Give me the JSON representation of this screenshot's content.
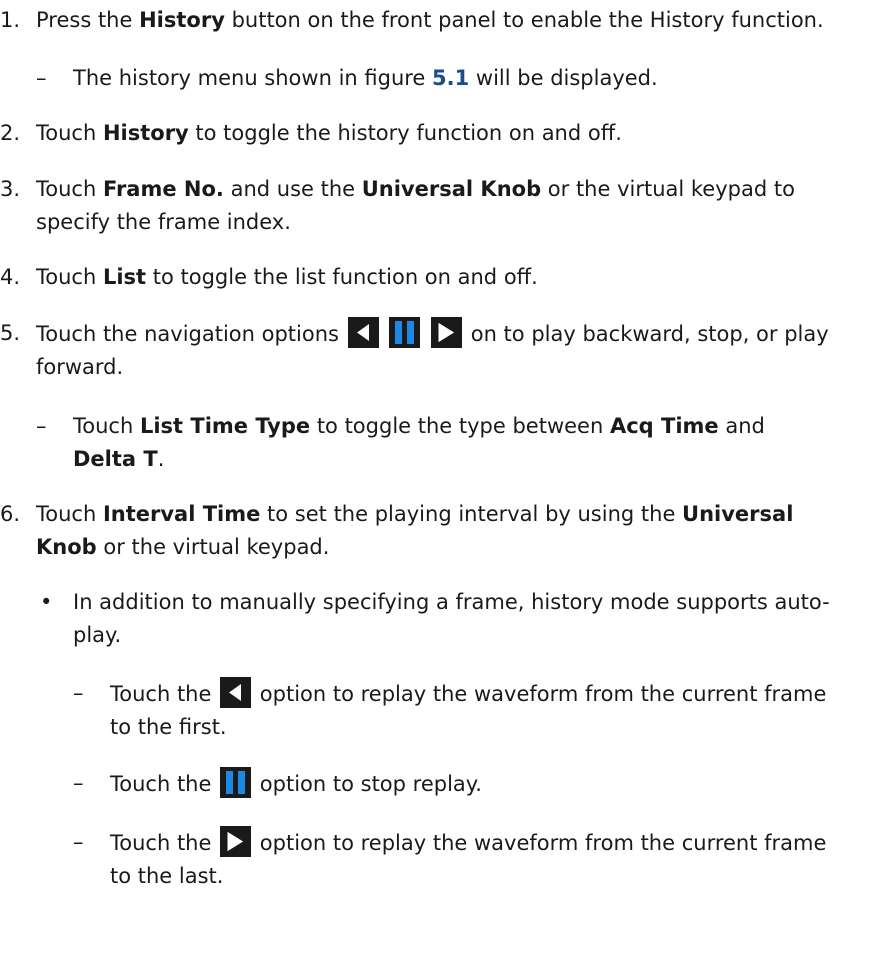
{
  "steps": [
    {
      "num": "1.",
      "parts": [
        "Press the ",
        "History",
        " button on the front panel to enable the History function."
      ]
    },
    {
      "num": "2.",
      "parts": [
        "Touch ",
        "History",
        " to toggle the history function on and off."
      ]
    },
    {
      "num": "3.",
      "parts": [
        "Touch ",
        "Frame No.",
        " and use the ",
        "Universal Knob",
        " or the virtual keypad to",
        "specify the frame index."
      ]
    },
    {
      "num": "4.",
      "parts": [
        "Touch ",
        "List",
        " to toggle the list function on and off."
      ]
    },
    {
      "num": "5.",
      "parts": [
        "Touch the navigation options",
        " on to play backward, stop, or play",
        "forward."
      ]
    },
    {
      "num": "6.",
      "parts": [
        "Touch ",
        "Interval Time",
        " to set the playing interval by using the ",
        "Universal",
        "Knob",
        " or the virtual keypad."
      ]
    }
  ],
  "sub1": {
    "dash": "–",
    "parts": [
      "The history menu shown in figure ",
      "5.1",
      " will be displayed."
    ]
  },
  "sub5": {
    "dash": "–",
    "parts": [
      "Touch ",
      "List Time Type",
      " to toggle the type between ",
      "Acq Time",
      " and",
      "Delta T",
      "."
    ]
  },
  "bullet": {
    "mark": "•",
    "parts": [
      "In addition to manually specifying a frame, history mode supports auto-",
      "play."
    ]
  },
  "autoplay": [
    {
      "dash": "–",
      "pre": "Touch the",
      "post": "option to replay the waveform from the current frame",
      "post2": "to the first.",
      "icon": "play-backward-icon"
    },
    {
      "dash": "–",
      "pre": "Touch the",
      "post": "option to stop replay.",
      "post2": "",
      "icon": "pause-icon"
    },
    {
      "dash": "–",
      "pre": "Touch the",
      "post": "option to replay the waveform from the current frame",
      "post2": "to the last.",
      "icon": "play-forward-icon"
    }
  ],
  "colors": {
    "icon_left_bg": "#1a1a1a",
    "icon_pause": "#1e88e5",
    "link": "#1e4b8c"
  }
}
